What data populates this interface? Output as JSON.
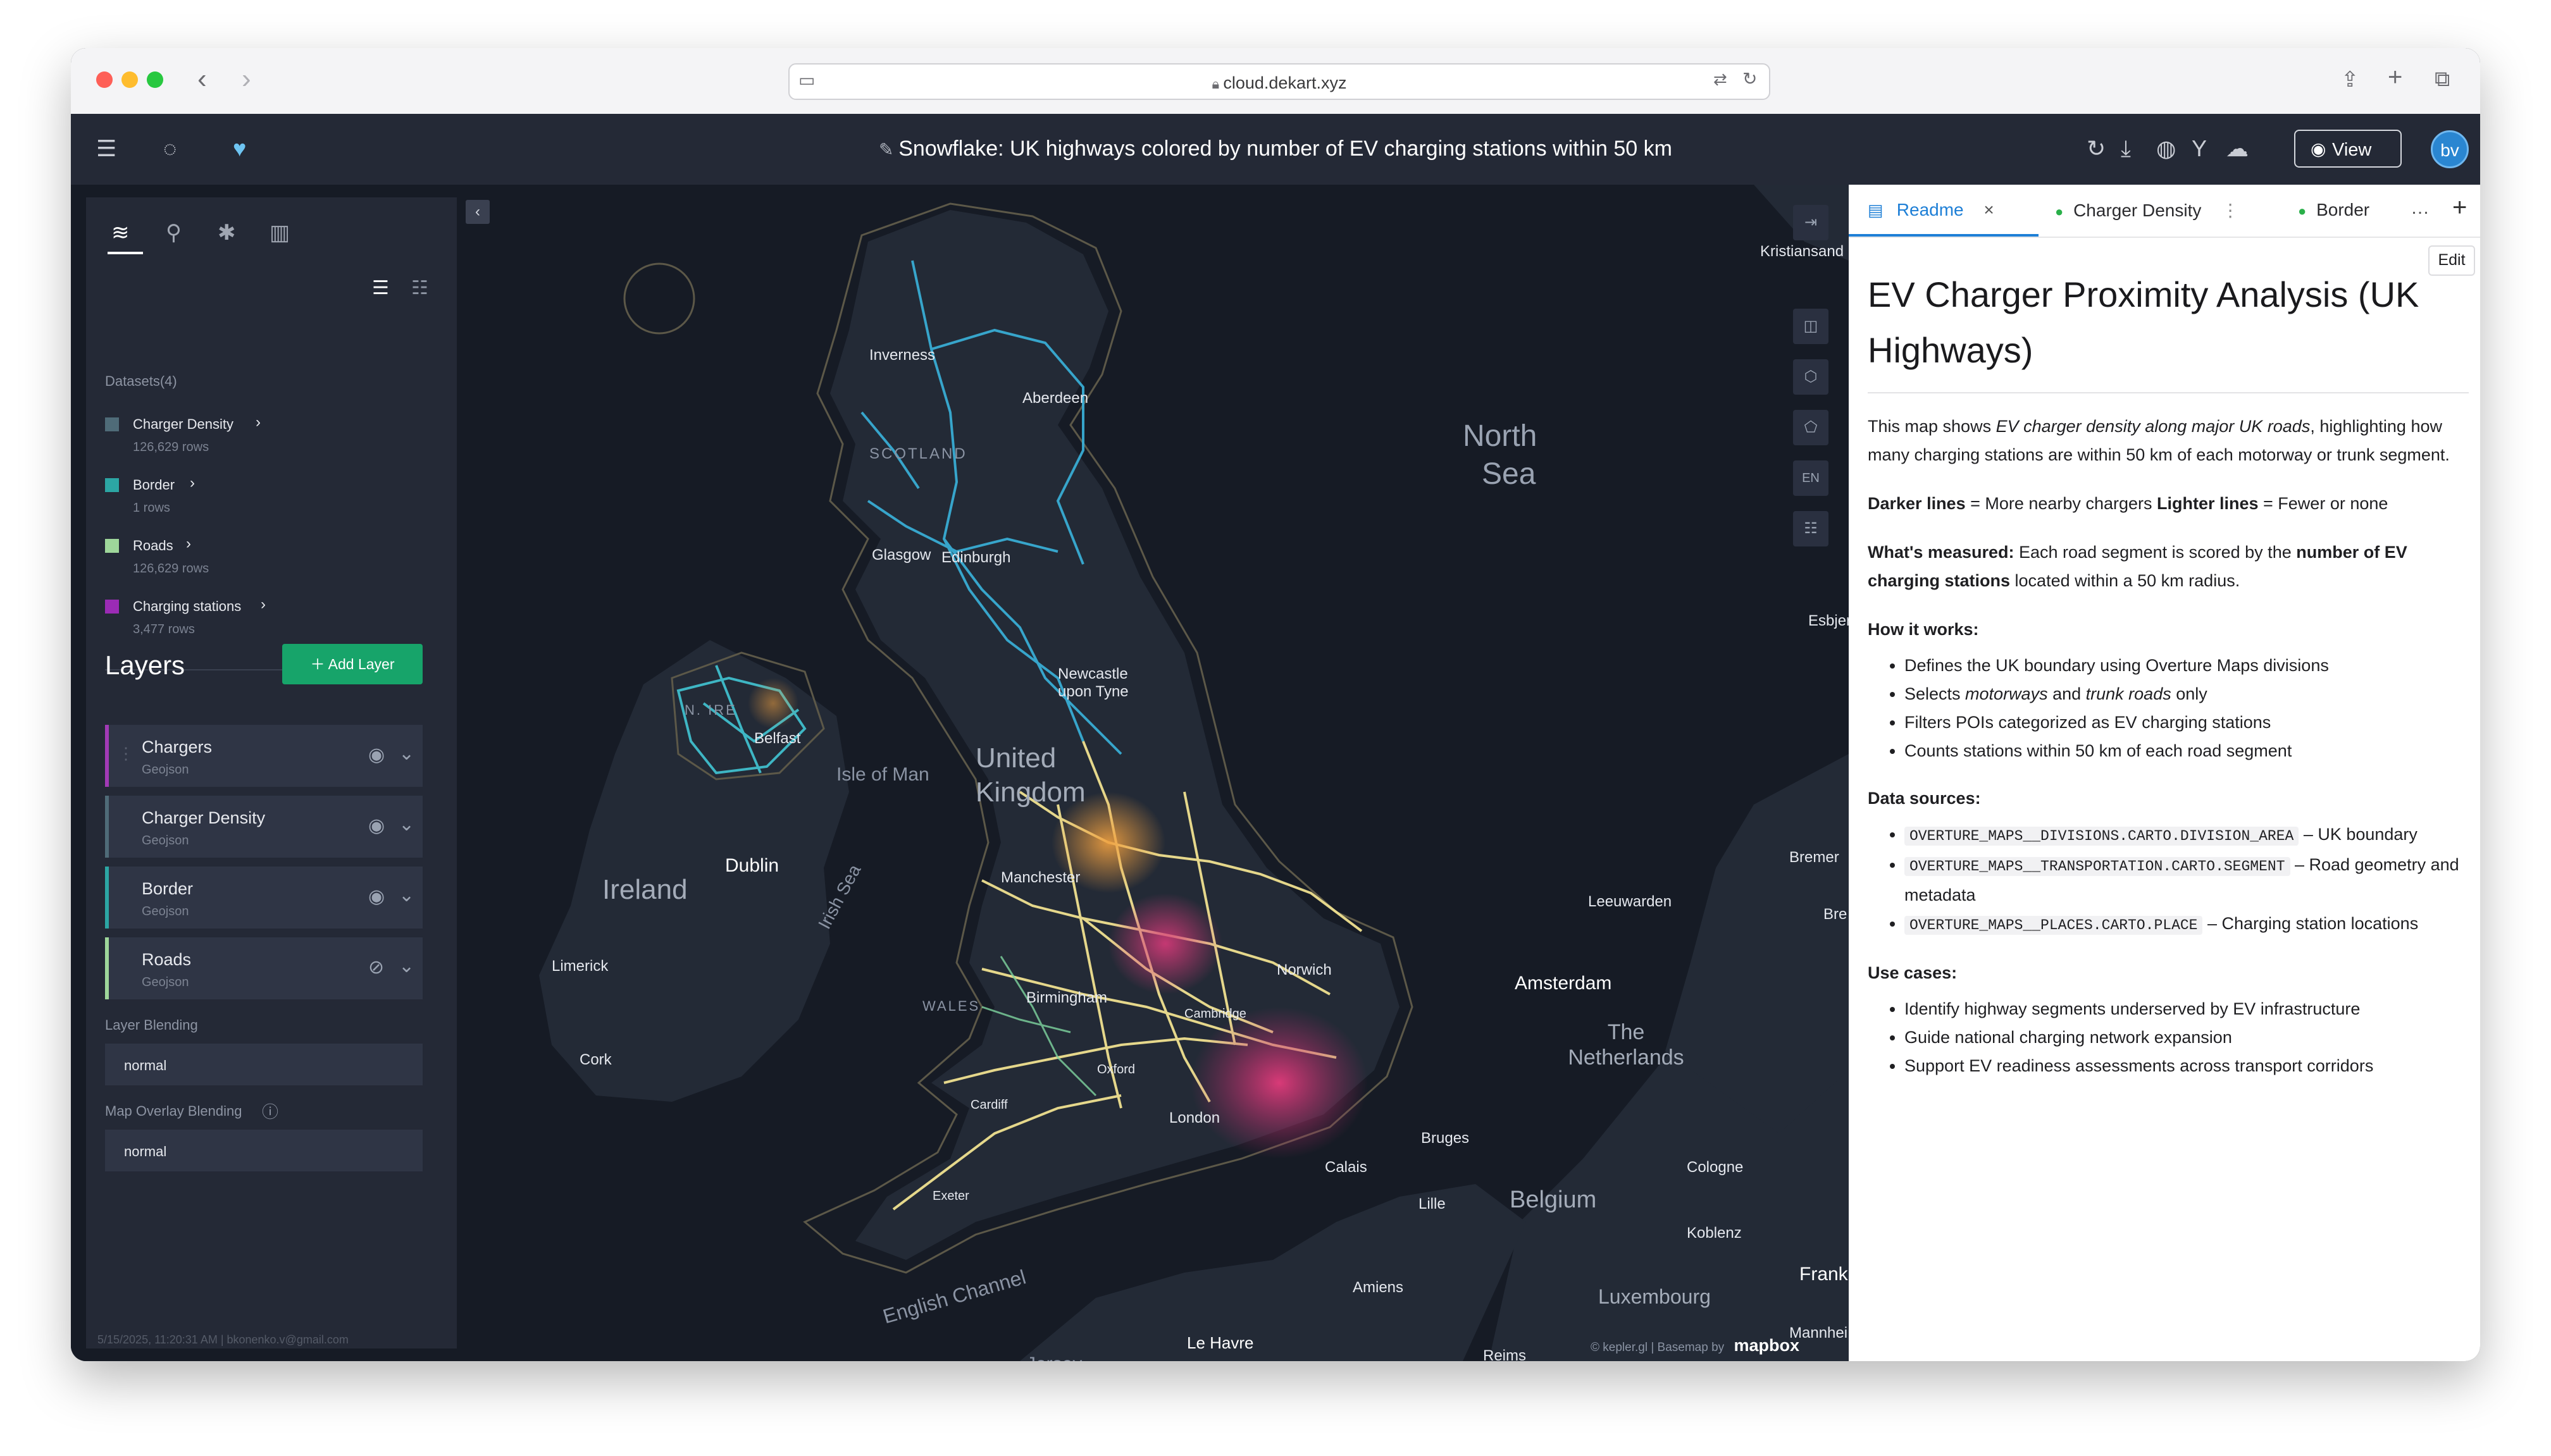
{
  "browser": {
    "url": "cloud.dekart.xyz"
  },
  "header": {
    "title": "Snowflake: UK highways colored by number of EV charging stations within 50 km",
    "view_label": "View",
    "avatar_initials": "bv"
  },
  "sidebar": {
    "datasets_label": "Datasets(4)",
    "datasets": [
      {
        "name": "Charger Density",
        "rows": "126,629 rows",
        "color": "#4f6b78"
      },
      {
        "name": "Border",
        "rows": "1 rows",
        "color": "#2ca6a4"
      },
      {
        "name": "Roads",
        "rows": "126,629 rows",
        "color": "#9ed69a"
      },
      {
        "name": "Charging stations",
        "rows": "3,477 rows",
        "color": "#9b2bb5"
      }
    ],
    "layers_title": "Layers",
    "add_layer_label": "Add Layer",
    "layers": [
      {
        "name": "Chargers",
        "type": "Geojson",
        "color": "#a23ab6"
      },
      {
        "name": "Charger Density",
        "type": "Geojson",
        "color": "#4f6b78"
      },
      {
        "name": "Border",
        "type": "Geojson",
        "color": "#2ca6a4"
      },
      {
        "name": "Roads",
        "type": "Geojson",
        "color": "#9ed69a"
      }
    ],
    "layer_blending_label": "Layer Blending",
    "layer_blending_value": "normal",
    "map_overlay_label": "Map Overlay Blending",
    "map_overlay_value": "normal",
    "footer_text": "5/15/2025, 11:20:31 AM | bkonenko.v@gmail.com"
  },
  "map": {
    "labels": {
      "north_sea": "North",
      "north_sea_2": "Sea",
      "scotland": "SCOTLAND",
      "inverness": "Inverness",
      "aberdeen": "Aberdeen",
      "glasgow": "Glasgow",
      "edinburgh": "Edinburgh",
      "n_ire": "N. IRE",
      "belfast": "Belfast",
      "isle_of_man": "Isle of Man",
      "newcastle": "Newcastle upon Tyne",
      "united_kingdom": "United Kingdom",
      "ireland": "Ireland",
      "dublin": "Dublin",
      "irish_sea": "Irish Sea",
      "limerick": "Limerick",
      "cork": "Cork",
      "manchester": "Manchester",
      "birmingham": "Birmingham",
      "wales": "WALES",
      "norwich": "Norwich",
      "cambridge": "Cambridge",
      "oxford": "Oxford",
      "cardiff": "Cardiff",
      "london": "London",
      "exeter": "Exeter",
      "english_channel": "English Channel",
      "jersey": "Jersey",
      "le_havre": "Le Havre",
      "amiens": "Amiens",
      "calais": "Calais",
      "bruges": "Bruges",
      "lille": "Lille",
      "belgium": "Belgium",
      "amsterdam": "Amsterdam",
      "netherlands": "The Netherlands",
      "leeuwarden": "Leeuwarden",
      "bremen": "Bremer",
      "esbjerg": "Esbjerg",
      "kristiansand": "Kristiansand",
      "cologne": "Cologne",
      "koblenz": "Koblenz",
      "luxembourg": "Luxembourg",
      "reims": "Reims",
      "frank": "Frank",
      "mannheim": "Mannhei",
      "bre": "Bre"
    },
    "lang_button": "EN",
    "attribution": "© kepler.gl | Basemap by",
    "mapbox": "mapbox"
  },
  "readme": {
    "tabs": [
      {
        "label": "Readme"
      },
      {
        "label": "Charger Density"
      },
      {
        "label": "Border"
      }
    ],
    "edit_label": "Edit",
    "title": "EV Charger Proximity Analysis (UK Highways)",
    "intro_1": "This map shows ",
    "intro_em": "EV charger density along major UK roads",
    "intro_2": ", highlighting how many charging stations are within 50 km of each motorway or trunk segment.",
    "darker_b": "Darker lines",
    "darker_t": " = More nearby chargers ",
    "lighter_b": "Lighter lines",
    "lighter_t": " = Fewer or none",
    "measured_b": "What's measured:",
    "measured_t1": " Each road segment is scored by the ",
    "measured_b2": "number of EV charging stations",
    "measured_t2": " located within a 50 km radius.",
    "how_b": "How it works:",
    "how": [
      "Defines the UK boundary using Overture Maps divisions",
      "Filters POIs categorized as EV charging stations",
      "Counts stations within 50 km of each road segment"
    ],
    "how_selects_1": "Selects ",
    "how_selects_em1": "motorways",
    "how_selects_2": " and ",
    "how_selects_em2": "trunk roads",
    "how_selects_3": " only",
    "sources_b": "Data sources:",
    "sources": [
      {
        "code": "OVERTURE_MAPS__DIVISIONS.CARTO.DIVISION_AREA",
        "desc": " – UK boundary"
      },
      {
        "code": "OVERTURE_MAPS__TRANSPORTATION.CARTO.SEGMENT",
        "desc": " – Road geometry and metadata"
      },
      {
        "code": "OVERTURE_MAPS__PLACES.CARTO.PLACE",
        "desc": " – Charging station locations"
      }
    ],
    "use_b": "Use cases:",
    "use_cases": [
      "Identify highway segments underserved by EV infrastructure",
      "Guide national charging network expansion",
      "Support EV readiness assessments across transport corridors"
    ]
  }
}
